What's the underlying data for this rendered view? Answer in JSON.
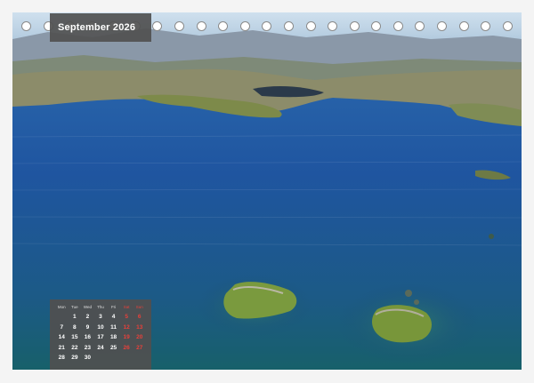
{
  "calendar_page": {
    "month_label": "September 2026",
    "ring_count": 23,
    "weekday_headers": [
      "Mon",
      "Tue",
      "Wed",
      "Thu",
      "Fri",
      "Sat",
      "Sun"
    ],
    "weeks": [
      [
        "",
        "1",
        "2",
        "3",
        "4",
        "5",
        "6"
      ],
      [
        "7",
        "8",
        "9",
        "10",
        "11",
        "12",
        "13"
      ],
      [
        "14",
        "15",
        "16",
        "17",
        "18",
        "19",
        "20"
      ],
      [
        "21",
        "22",
        "23",
        "24",
        "25",
        "26",
        "27"
      ],
      [
        "28",
        "29",
        "30",
        "",
        "",
        "",
        ""
      ]
    ]
  },
  "colors": {
    "weekend": "#e8403a",
    "label_background": "#505050",
    "lake_blue": "#1f4d8c"
  }
}
